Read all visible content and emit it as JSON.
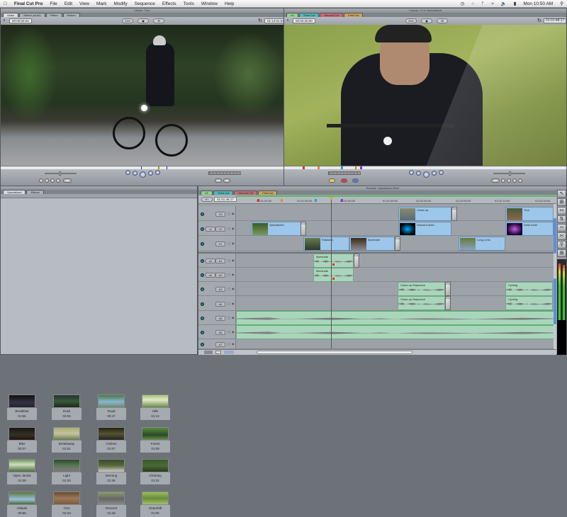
{
  "menubar": {
    "apple": "",
    "app": "Final Cut Pro",
    "items": [
      "File",
      "Edit",
      "View",
      "Mark",
      "Modify",
      "Sequence",
      "Effects",
      "Tools",
      "Window",
      "Help"
    ],
    "clock": "Mon 10:50 AM"
  },
  "viewer": {
    "title": "Viewer: Turn",
    "tabs": [
      "Video",
      "Stereo (a1a2)",
      "Filters",
      "Motion"
    ],
    "timecode_left": "00:00:02:04",
    "timecode_right": "01:14:01:02",
    "zoom": "33%",
    "view": "▣",
    "overlay": "⊞"
  },
  "canvas": {
    "title": "Canvas: V1 in Specialized",
    "tabs": [
      "V1",
      "Third Cut",
      "Second Cut",
      "First Cut"
    ],
    "timecode_left": "00:02:20:00",
    "timecode_right": "01:01:48:17",
    "zoom": "33%"
  },
  "browser": {
    "tabs": [
      "Specialized",
      "Effects"
    ],
    "clips": [
      {
        "name": "Breakfast",
        "duration": "01:56"
      },
      {
        "name": "Dusk",
        "duration": "02:03"
      },
      {
        "name": "Road",
        "duration": "00:47"
      },
      {
        "name": "Hills",
        "duration": "01:13"
      },
      {
        "name": "Bike",
        "duration": "00:27"
      },
      {
        "name": "Breakaway",
        "duration": "01:51"
      },
      {
        "name": "Clothes",
        "duration": "01:07"
      },
      {
        "name": "Forest",
        "duration": "01:09"
      },
      {
        "name": "Open Jacket",
        "duration": "01:39"
      },
      {
        "name": "Light",
        "duration": "01:20"
      },
      {
        "name": "Morning",
        "duration": "01:36"
      },
      {
        "name": "Climbing",
        "duration": "01:32"
      },
      {
        "name": "Altitude",
        "duration": "00:59"
      },
      {
        "name": "Turn",
        "duration": "02:19"
      },
      {
        "name": "Descent",
        "duration": "01:40"
      },
      {
        "name": "Gearshift",
        "duration": "01:05"
      }
    ]
  },
  "timeline": {
    "title": "Timeline: Specialized Reel",
    "tabs": [
      "V1",
      "Third Cut",
      "Second Cut",
      "First Cut"
    ],
    "rt": "RT",
    "timecode": "01:01:48:17",
    "ruler": [
      "01:01:40:00",
      "01:01:45:00",
      "01:01:50:00",
      "01:01:55:00",
      "01:02:00:00",
      "01:02:05:00",
      "01:02:10:00",
      "01:02:15:00"
    ],
    "tracks": [
      {
        "link": "",
        "name": "V3"
      },
      {
        "link": "v1",
        "name": "V2"
      },
      {
        "link": "",
        "name": "V1"
      },
      {
        "link": "a1",
        "name": "A1"
      },
      {
        "link": "a2",
        "name": "A2"
      },
      {
        "link": "",
        "name": "A3"
      },
      {
        "link": "",
        "name": "A4"
      },
      {
        "link": "",
        "name": "A5"
      },
      {
        "link": "",
        "name": "A6"
      },
      {
        "link": "",
        "name": "A7"
      }
    ],
    "video_clips": [
      "Specialized",
      "Flatlands",
      "Illuminate",
      "Close-up",
      "Turn",
      "Descent.motn",
      "Dusk.motn",
      "Long Lens"
    ],
    "audio_clips": [
      "Illuminate",
      "Illuminate",
      "Close-up Sequence",
      "Close-up Sequence",
      "Cycling",
      "Cycling"
    ],
    "transition": "Cro"
  },
  "colors": {
    "video_clip": "#9cc6ea",
    "audio_clip": "#a9d6bb",
    "track_on": "#2e9a44",
    "tab_v1": "#8fd08a",
    "tab_third": "#4fb8b8",
    "tab_second": "#c76a7a",
    "tab_first": "#c9a25c"
  }
}
